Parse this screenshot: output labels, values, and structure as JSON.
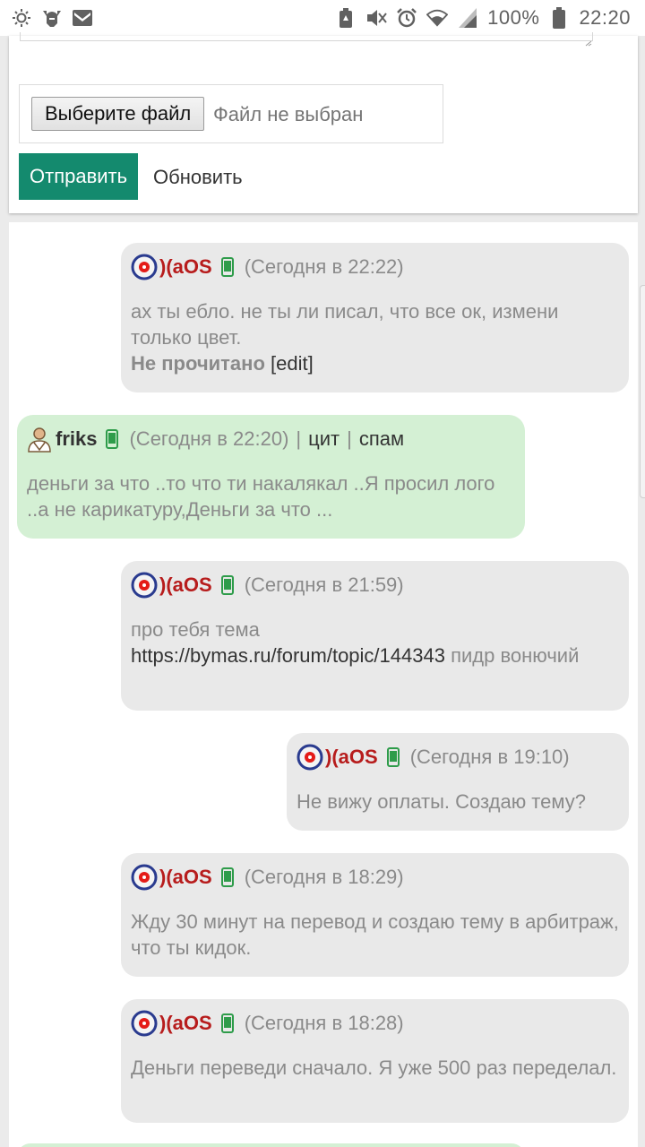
{
  "status_bar": {
    "battery_percent": "100%",
    "time": "22:20",
    "icons_left": [
      "sun-icon",
      "viking-helmet-icon",
      "gmail-icon"
    ],
    "icons_right": [
      "battery-saver-icon",
      "mute-icon",
      "alarm-icon",
      "wifi-icon",
      "signal-icon",
      "battery-icon"
    ]
  },
  "form": {
    "file_button": "Выберите файл",
    "file_status": "Файл не выбран",
    "submit_label": "Отправить",
    "refresh_label": "Обновить"
  },
  "messages": [
    {
      "user": ")(aOS",
      "time": "(Сегодня в 22:22)",
      "text": "ах ты ебло. не ты ли писал, что все ок, измени только цвет.",
      "read_status": "Не прочитано",
      "edit_label": "[edit]"
    },
    {
      "user": "friks",
      "time": "(Сегодня в 22:20)",
      "separator": "|",
      "quote_label": "цит",
      "spam_label": "спам",
      "text": "деньги за что ..то что ти накалякал ..Я просил лого ..а не карикатуру,Деньги за что ..."
    },
    {
      "user": ")(aOS",
      "time": "(Сегодня в 21:59)",
      "text_before": "про тебя тема",
      "link": "https://bymas.ru/forum/topic/144343",
      "text_after": "пидр вонючий"
    },
    {
      "user": ")(aOS",
      "time": "(Сегодня в 19:10)",
      "text": "Не вижу оплаты. Создаю тему?"
    },
    {
      "user": ")(aOS",
      "time": "(Сегодня в 18:29)",
      "text": "Жду 30 минут на перевод и создаю тему в арбитраж, что ты кидок."
    },
    {
      "user": ")(aOS",
      "time": "(Сегодня в 18:28)",
      "text": "Деньги переведи сначало. Я уже 500 раз переделал."
    }
  ],
  "colors": {
    "accent_green": "#148a6e",
    "username_red": "#b71c1c",
    "bubble_grey": "#e9e9e9",
    "bubble_green": "#d4f0d4"
  }
}
